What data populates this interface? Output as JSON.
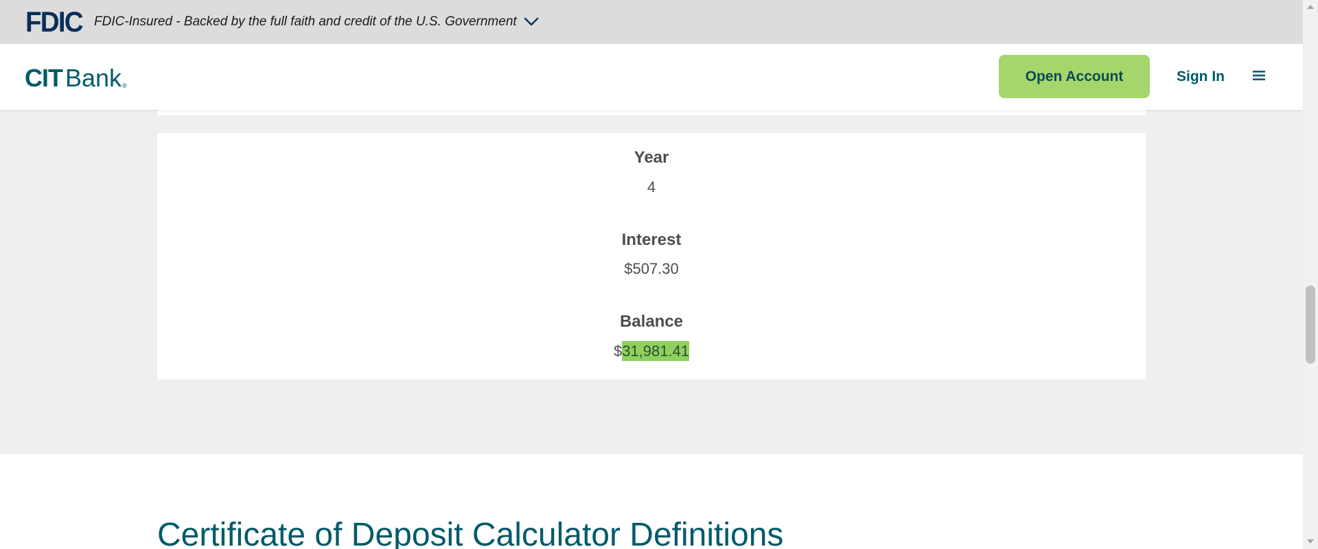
{
  "fdic_banner": {
    "logo_text": "FDIC",
    "text": "FDIC-Insured - Backed by the full faith and credit of the U.S. Government",
    "expand_icon": "chevron-down-icon"
  },
  "header": {
    "logo": {
      "cit": "CIT",
      "bank": "Bank",
      "reg": "®"
    },
    "open_account_label": "Open Account",
    "sign_in_label": "Sign In",
    "menu_icon": "hamburger-menu-icon"
  },
  "result": {
    "year_label": "Year",
    "year_value": "4",
    "interest_label": "Interest",
    "interest_value": "$507.30",
    "balance_label": "Balance",
    "balance_currency": "$",
    "balance_value": "31,981.41"
  },
  "definitions": {
    "title": "Certificate of Deposit Calculator Definitions"
  },
  "colors": {
    "fdic_navy": "#0b2e5b",
    "brand_teal": "#005a6a",
    "cta_green": "#a5d66b",
    "highlight_green": "#8fd15c",
    "band_gray": "#efefef"
  }
}
